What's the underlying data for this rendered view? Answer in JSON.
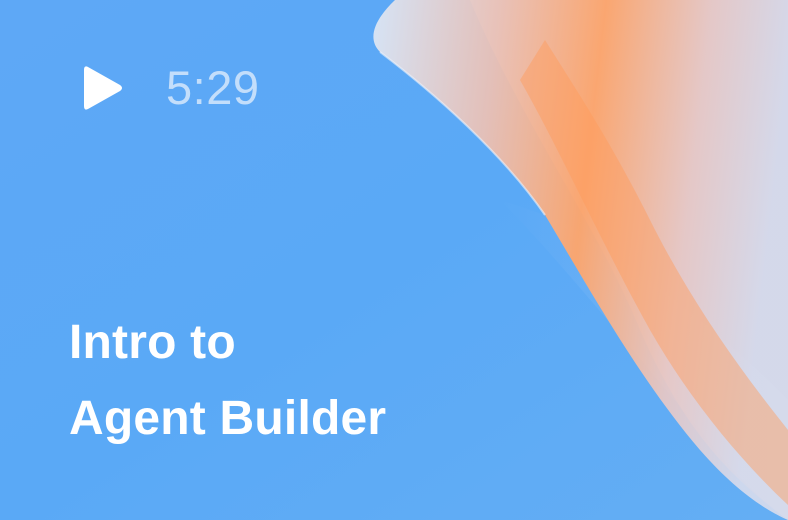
{
  "video_card": {
    "duration": "5:29",
    "title_line1": "Intro to",
    "title_line2": "Agent Builder"
  },
  "icons": {
    "play": "play-icon"
  },
  "colors": {
    "background_blue": "#5aa9f5",
    "accent_orange": "#ffa56a",
    "title_text": "#ffffff",
    "duration_text": "#ecf3fc"
  }
}
